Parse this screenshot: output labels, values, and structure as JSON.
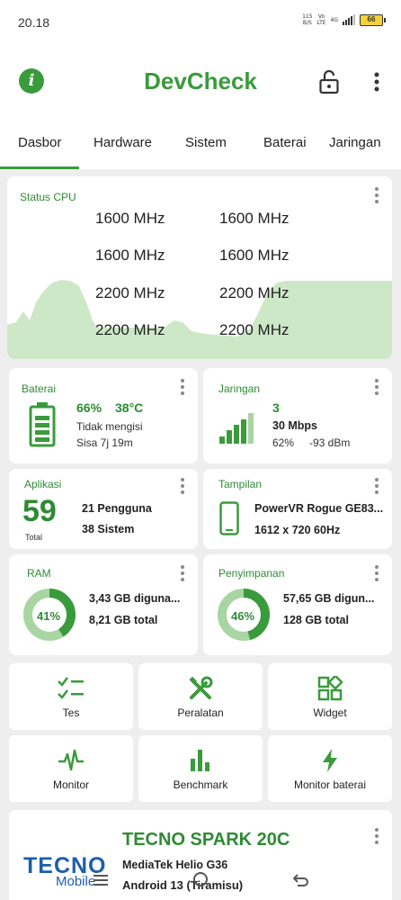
{
  "status_bar": {
    "time": "20.18",
    "speed": "115",
    "speed_unit": "B/S",
    "volte_top": "Vo",
    "volte_bottom": "LTE",
    "network": "4G",
    "battery": "66"
  },
  "app": {
    "title": "DevCheck"
  },
  "tabs": [
    {
      "label": "Dasbor",
      "active": true
    },
    {
      "label": "Hardware"
    },
    {
      "label": "Sistem"
    },
    {
      "label": "Baterai"
    },
    {
      "label": "Jaringan"
    }
  ],
  "cpu": {
    "title": "Status CPU",
    "cores": [
      "1600 MHz",
      "1600 MHz",
      "1600 MHz",
      "1600 MHz",
      "2200 MHz",
      "2200 MHz",
      "2200 MHz",
      "2200 MHz"
    ]
  },
  "battery": {
    "title": "Baterai",
    "level": "66%",
    "temp": "38°C",
    "status": "Tidak mengisi",
    "remaining": "Sisa 7j 19m"
  },
  "network": {
    "title": "Jaringan",
    "type": "3",
    "speed": "30 Mbps",
    "signal_percent": "62%",
    "signal_dbm": "-93 dBm"
  },
  "apps": {
    "title": "Aplikasi",
    "count": "59",
    "count_label": "Total",
    "user": "21 Pengguna",
    "system": "38 Sistem"
  },
  "display": {
    "title": "Tampilan",
    "gpu": "PowerVR Rogue GE83...",
    "resolution": "1612 x 720  60Hz"
  },
  "ram": {
    "title": "RAM",
    "percent": "41%",
    "percent_value": 41,
    "used": "3,43 GB diguna...",
    "total": "8,21 GB total"
  },
  "storage": {
    "title": "Penyimpanan",
    "percent": "46%",
    "percent_value": 46,
    "used": "57,65 GB digun...",
    "total": "128 GB total"
  },
  "tools": [
    {
      "label": "Tes",
      "icon": "checklist-icon"
    },
    {
      "label": "Peralatan",
      "icon": "tools-icon"
    },
    {
      "label": "Widget",
      "icon": "widget-icon"
    },
    {
      "label": "Monitor",
      "icon": "pulse-icon"
    },
    {
      "label": "Benchmark",
      "icon": "bar-chart-icon"
    },
    {
      "label": "Monitor baterai",
      "icon": "lightning-icon"
    }
  ],
  "device": {
    "brand_logo": "TECNO",
    "brand_sub": "Mobile",
    "name": "TECNO SPARK 20C",
    "chipset": "MediaTek Helio G36",
    "os": "Android 13 (Tiramisu)"
  },
  "colors": {
    "accent": "#3a9b3c",
    "accent_light": "#a8d5a2",
    "graph_fill": "#cde8c7",
    "background": "#eeeeee",
    "logo_blue": "#1d5fa8"
  }
}
